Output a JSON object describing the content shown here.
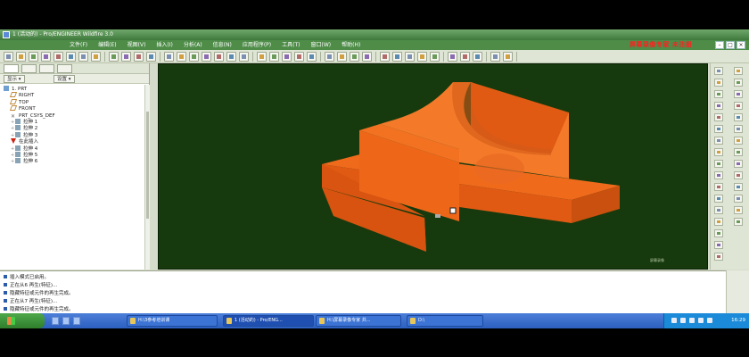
{
  "window": {
    "title": "1 (活动的) - Pro/ENGINEER Wildfire 3.0"
  },
  "menu": {
    "items": [
      "文件(F)",
      "编辑(E)",
      "视图(V)",
      "插入(I)",
      "分析(A)",
      "信息(N)",
      "应用程序(P)",
      "工具(T)",
      "窗口(W)",
      "帮助(H)"
    ],
    "recorder_text": "屏幕录像专家 未注册"
  },
  "model_tree": {
    "show_label": "显示",
    "settings_label": "设置",
    "nodes": [
      {
        "label": "1. PRT",
        "icon": "part-icon"
      },
      {
        "label": "RIGHT",
        "icon": "datum-plane-icon"
      },
      {
        "label": "TOP",
        "icon": "datum-plane-icon"
      },
      {
        "label": "FRONT",
        "icon": "datum-plane-icon"
      },
      {
        "label": "PRT_CSYS_DEF",
        "icon": "csys-icon"
      },
      {
        "label": "拉伸 1",
        "icon": "extrude-icon"
      },
      {
        "label": "拉伸 2",
        "icon": "extrude-icon"
      },
      {
        "label": "拉伸 3",
        "icon": "extrude-icon"
      },
      {
        "label": "在此插入",
        "icon": "insert-here-icon"
      },
      {
        "label": "拉伸 4",
        "icon": "extrude-icon"
      },
      {
        "label": "拉伸 5",
        "icon": "extrude-icon"
      },
      {
        "label": "拉伸 6",
        "icon": "extrude-icon"
      }
    ]
  },
  "viewport": {
    "background": "#163a0d",
    "model_color": "#f06a1c",
    "watermark": "屏幕录像"
  },
  "messages": [
    "插入模式已启用。",
    "正在从6 再生(特征)...",
    "隐藏特征或元件的再生完成。",
    "正在从7 再生(特征)...",
    "隐藏特征或元件的再生完成。"
  ],
  "status": {
    "filter_label": "智能"
  },
  "taskbar": {
    "tasks": [
      "H:\\3参考培训课",
      "1 (活动的) - Pro/ENG...",
      "H:\\屏幕录像专家 共...",
      "D:\\"
    ],
    "clock": "16:29"
  }
}
